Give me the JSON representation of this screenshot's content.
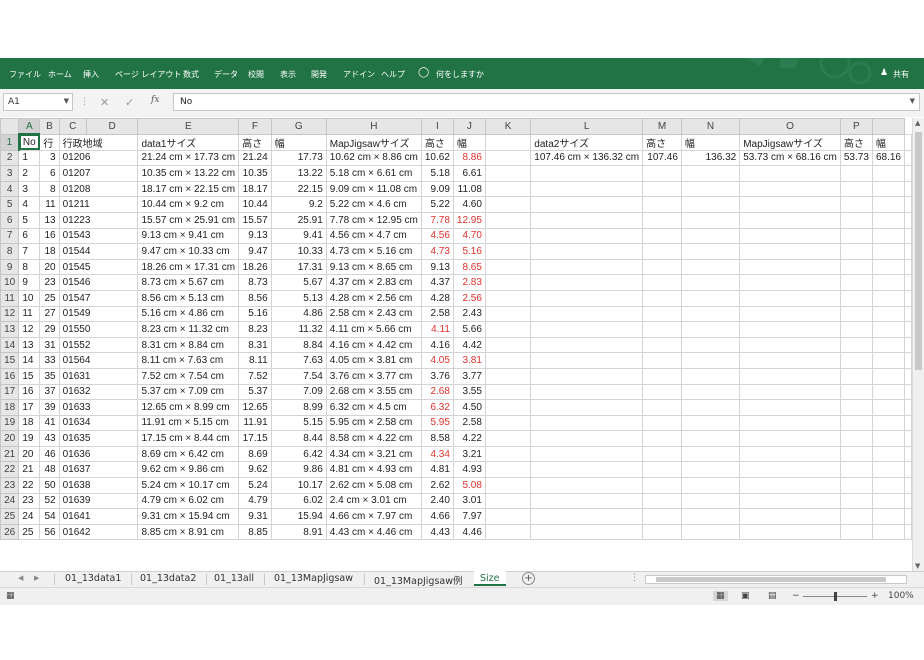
{
  "ribbon": {
    "tabs": [
      "ファイル",
      "ホーム",
      "挿入",
      "ページ レイアウト",
      "数式",
      "データ",
      "校閲",
      "表示",
      "開発",
      "アドイン",
      "ヘルプ"
    ],
    "tell_me": "何をしますか",
    "share": "共有",
    "color": "#217346"
  },
  "formula_bar": {
    "name_box": "A1",
    "value": "No"
  },
  "columns": [
    "A",
    "B",
    "C",
    "D",
    "E",
    "F",
    "G",
    "H",
    "I",
    "J",
    "K",
    "L",
    "M",
    "N",
    "O",
    "P"
  ],
  "header_row": [
    "No",
    "行",
    "行政地域",
    "data1サイズ",
    "高さ",
    "幅",
    "MapJigsawサイズ",
    "高さ",
    "幅",
    "",
    "data2サイズ",
    "高さ",
    "幅",
    "MapJigsawサイズ",
    "高さ",
    "幅"
  ],
  "rows": [
    {
      "n": "2",
      "a": "1",
      "b": "3",
      "c": "01206",
      "d": "21.24 cm × 17.73 cm",
      "e": "21.24",
      "f": "17.73",
      "g": "10.62 cm × 8.86 cm",
      "h": "10.62",
      "i": "8.86",
      "k": "107.46 cm × 136.32 cm",
      "l": "107.46",
      "m": "136.32",
      "nn": "53.73 cm × 68.16 cm",
      "o": "53.73",
      "p": "68.16"
    },
    {
      "n": "3",
      "a": "2",
      "b": "6",
      "c": "01207",
      "d": "10.35 cm × 13.22 cm",
      "e": "10.35",
      "f": "13.22",
      "g": "5.18 cm × 6.61 cm",
      "h": "5.18",
      "i": "6.61"
    },
    {
      "n": "4",
      "a": "3",
      "b": "8",
      "c": "01208",
      "d": "18.17 cm × 22.15 cm",
      "e": "18.17",
      "f": "22.15",
      "g": "9.09 cm × 11.08 cm",
      "h": "9.09",
      "i": "11.08"
    },
    {
      "n": "5",
      "a": "4",
      "b": "11",
      "c": "01211",
      "d": "10.44 cm × 9.2 cm",
      "e": "10.44",
      "f": "9.2",
      "g": "5.22 cm × 4.6 cm",
      "h": "5.22",
      "i": "4.60"
    },
    {
      "n": "6",
      "a": "5",
      "b": "13",
      "c": "01223",
      "d": "15.57 cm × 25.91 cm",
      "e": "15.57",
      "f": "25.91",
      "g": "7.78 cm × 12.95 cm",
      "h": "7.78",
      "i": "12.95"
    },
    {
      "n": "7",
      "a": "6",
      "b": "16",
      "c": "01543",
      "d": "9.13 cm × 9.41 cm",
      "e": "9.13",
      "f": "9.41",
      "g": "4.56 cm × 4.7 cm",
      "h": "4.56",
      "i": "4.70"
    },
    {
      "n": "8",
      "a": "7",
      "b": "18",
      "c": "01544",
      "d": " 9.47 cm × 10.33 cm",
      "e": "9.47",
      "f": "10.33",
      "g": "4.73 cm × 5.16 cm",
      "h": "4.73",
      "i": "5.16"
    },
    {
      "n": "9",
      "a": "8",
      "b": "20",
      "c": "01545",
      "d": "18.26 cm × 17.31 cm",
      "e": "18.26",
      "f": "17.31",
      "g": "9.13 cm × 8.65 cm",
      "h": "9.13",
      "i": "8.65"
    },
    {
      "n": "10",
      "a": "9",
      "b": "23",
      "c": "01546",
      "d": "8.73 cm × 5.67 cm",
      "e": "8.73",
      "f": "5.67",
      "g": "4.37 cm × 2.83 cm",
      "h": "4.37",
      "i": "2.83"
    },
    {
      "n": "11",
      "a": "10",
      "b": "25",
      "c": "01547",
      "d": "8.56 cm × 5.13 cm",
      "e": "8.56",
      "f": "5.13",
      "g": "4.28 cm × 2.56 cm",
      "h": "4.28",
      "i": "2.56"
    },
    {
      "n": "12",
      "a": "11",
      "b": "27",
      "c": "01549",
      "d": "5.16 cm × 4.86 cm",
      "e": "5.16",
      "f": "4.86",
      "g": "2.58 cm × 2.43 cm",
      "h": "2.58",
      "i": "2.43"
    },
    {
      "n": "13",
      "a": "12",
      "b": "29",
      "c": "01550",
      "d": "8.23 cm × 11.32 cm",
      "e": "8.23",
      "f": "11.32",
      "g": "4.11 cm × 5.66 cm",
      "h": "4.11",
      "i": "5.66"
    },
    {
      "n": "14",
      "a": "13",
      "b": "31",
      "c": "01552",
      "d": "8.31 cm × 8.84 cm",
      "e": "8.31",
      "f": "8.84",
      "g": "4.16 cm × 4.42 cm",
      "h": "4.16",
      "i": "4.42"
    },
    {
      "n": "15",
      "a": "14",
      "b": "33",
      "c": "01564",
      "d": "8.11 cm × 7.63 cm",
      "e": "8.11",
      "f": "7.63",
      "g": "4.05 cm × 3.81 cm",
      "h": "4.05",
      "i": "3.81"
    },
    {
      "n": "16",
      "a": "15",
      "b": "35",
      "c": "01631",
      "d": "7.52 cm × 7.54 cm",
      "e": "7.52",
      "f": "7.54",
      "g": "3.76 cm × 3.77 cm",
      "h": "3.76",
      "i": "3.77"
    },
    {
      "n": "17",
      "a": "16",
      "b": "37",
      "c": "01632",
      "d": "5.37 cm × 7.09 cm",
      "e": "5.37",
      "f": "7.09",
      "g": "2.68 cm × 3.55 cm",
      "h": "2.68",
      "i": "3.55"
    },
    {
      "n": "18",
      "a": "17",
      "b": "39",
      "c": "01633",
      "d": "12.65 cm × 8.99 cm",
      "e": "12.65",
      "f": "8.99",
      "g": "6.32 cm × 4.5 cm",
      "h": "6.32",
      "i": "4.50"
    },
    {
      "n": "19",
      "a": "18",
      "b": "41",
      "c": "01634",
      "d": "11.91 cm × 5.15 cm",
      "e": "11.91",
      "f": "5.15",
      "g": "5.95 cm × 2.58 cm",
      "h": "5.95",
      "i": "2.58"
    },
    {
      "n": "20",
      "a": "19",
      "b": "43",
      "c": "01635",
      "d": "17.15 cm × 8.44 cm",
      "e": "17.15",
      "f": "8.44",
      "g": "8.58 cm × 4.22 cm",
      "h": "8.58",
      "i": "4.22"
    },
    {
      "n": "21",
      "a": "20",
      "b": "46",
      "c": "01636",
      "d": "8.69 cm × 6.42 cm",
      "e": "8.69",
      "f": "6.42",
      "g": "4.34 cm × 3.21 cm",
      "h": "4.34",
      "i": "3.21"
    },
    {
      "n": "22",
      "a": "21",
      "b": "48",
      "c": "01637",
      "d": "9.62 cm × 9.86 cm",
      "e": "9.62",
      "f": "9.86",
      "g": "4.81 cm × 4.93 cm",
      "h": "4.81",
      "i": "4.93"
    },
    {
      "n": "23",
      "a": "22",
      "b": "50",
      "c": "01638",
      "d": "5.24 cm × 10.17 cm",
      "e": "5.24",
      "f": "10.17",
      "g": "2.62 cm × 5.08 cm",
      "h": "2.62",
      "i": "5.08"
    },
    {
      "n": "24",
      "a": "23",
      "b": "52",
      "c": "01639",
      "d": "4.79 cm × 6.02 cm",
      "e": "4.79",
      "f": "6.02",
      "g": "2.4 cm × 3.01 cm",
      "h": "2.40",
      "i": "3.01"
    },
    {
      "n": "25",
      "a": "24",
      "b": "54",
      "c": "01641",
      "d": "9.31 cm × 15.94 cm",
      "e": "9.31",
      "f": "15.94",
      "g": "4.66 cm × 7.97 cm",
      "h": "4.66",
      "i": "7.97"
    },
    {
      "n": "26",
      "a": "25",
      "b": "56",
      "c": "01642",
      "d": "8.85 cm × 8.91 cm",
      "e": "8.85",
      "f": "8.91",
      "g": "4.43 cm × 4.46 cm",
      "h": "4.43",
      "i": "4.46"
    }
  ],
  "sheet_tabs": [
    "01_13data1",
    "01_13data2",
    "01_13all",
    "01_13MapJigsaw",
    "01_13MapJigsaw例",
    "Size"
  ],
  "active_sheet": "Size",
  "status": {
    "zoom": "100%"
  }
}
